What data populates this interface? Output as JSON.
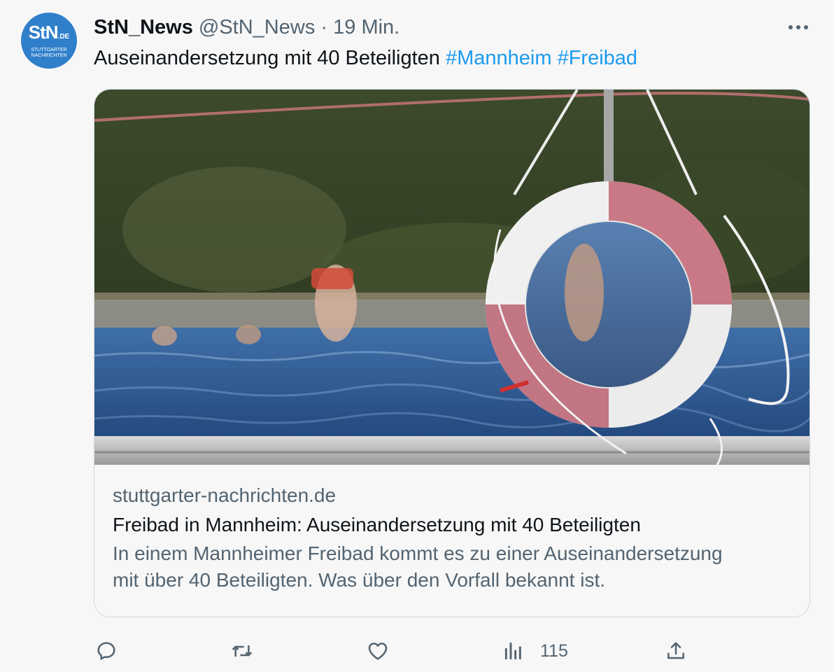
{
  "account": {
    "avatar_text": "StN",
    "avatar_suffix": ".DE",
    "avatar_sub_1": "STUTTGARTER",
    "avatar_sub_2": "NACHRICHTEN",
    "display_name": "StN_News",
    "handle": "@StN_News",
    "separator": "·",
    "timestamp": "19 Min."
  },
  "tweet": {
    "text": "Auseinandersetzung mit 40 Beteiligten ",
    "hashtags": [
      "#Mannheim",
      "#Freibad"
    ]
  },
  "card": {
    "image_icon": "pool-lifebuoy-photo",
    "domain": "stuttgarter-nachrichten.de",
    "title": "Freibad in Mannheim: Auseinandersetzung mit 40 Beteiligten",
    "description_line1": "In einem Mannheimer Freibad kommt es zu einer Auseinandersetzung",
    "description_line2": "mit über 40 Beteiligten. Was über den Vorfall bekannt ist."
  },
  "actions": {
    "reply_icon": "reply-icon",
    "retweet_icon": "retweet-icon",
    "like_icon": "heart-icon",
    "views_icon": "views-icon",
    "views_count": "115",
    "share_icon": "share-icon"
  },
  "colors": {
    "accent": "#1d9bf0",
    "secondary_text": "#536471",
    "avatar_bg": "#2f7fcb"
  }
}
